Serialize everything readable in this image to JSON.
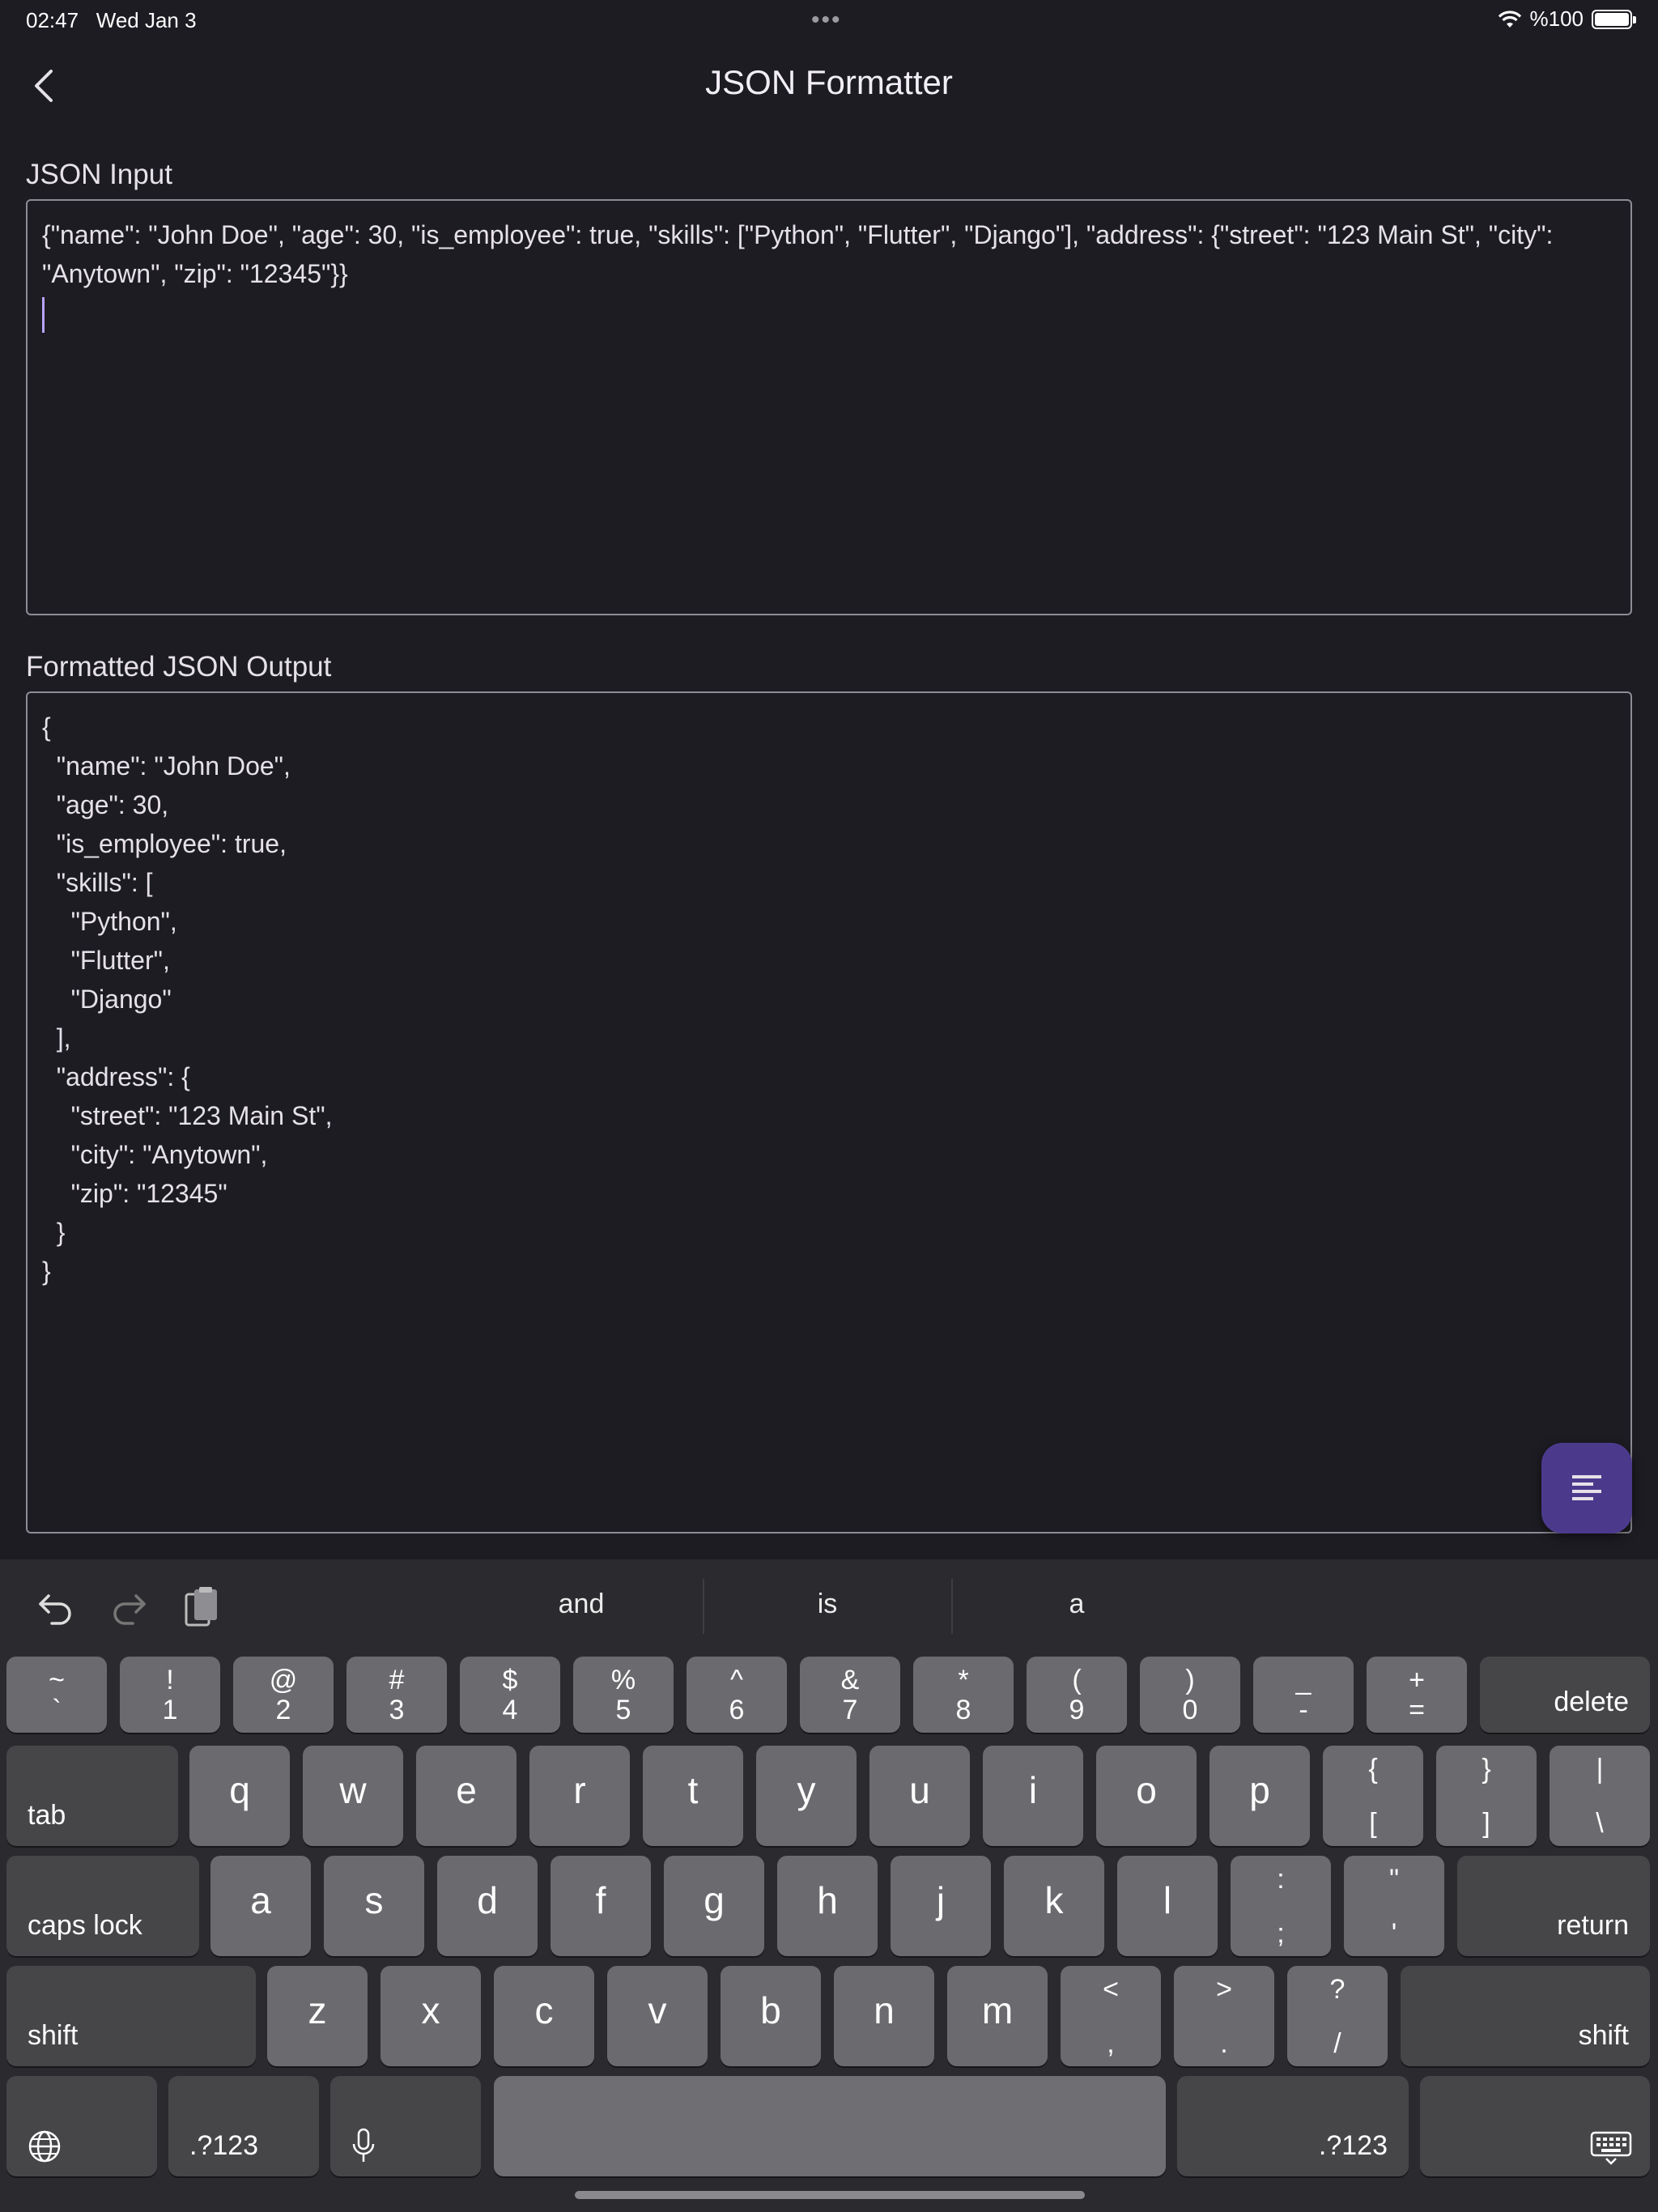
{
  "status": {
    "time": "02:47",
    "date": "Wed Jan 3",
    "battery": "%100",
    "dots": "•••"
  },
  "appbar": {
    "title": "JSON Formatter"
  },
  "input": {
    "label": "JSON Input",
    "value": "{\"name\": \"John Doe\", \"age\": 30, \"is_employee\": true, \"skills\": [\"Python\", \"Flutter\", \"Django\"], \"address\": {\"street\": \"123 Main St\", \"city\": \"Anytown\", \"zip\": \"12345\"}}\n"
  },
  "output": {
    "label": "Formatted JSON Output",
    "value": "{\n  \"name\": \"John Doe\",\n  \"age\": 30,\n  \"is_employee\": true,\n  \"skills\": [\n    \"Python\",\n    \"Flutter\",\n    \"Django\"\n  ],\n  \"address\": {\n    \"street\": \"123 Main St\",\n    \"city\": \"Anytown\",\n    \"zip\": \"12345\"\n  }\n}"
  },
  "keyboard": {
    "suggestions": [
      "and",
      "is",
      "a"
    ],
    "num": [
      [
        "~",
        "`"
      ],
      [
        "!",
        "1"
      ],
      [
        "@",
        "2"
      ],
      [
        "#",
        "3"
      ],
      [
        "$",
        "4"
      ],
      [
        "%",
        "5"
      ],
      [
        "^",
        "6"
      ],
      [
        "&",
        "7"
      ],
      [
        "*",
        "8"
      ],
      [
        "(",
        "9"
      ],
      [
        ")",
        "0"
      ],
      [
        "_",
        "-"
      ],
      [
        "+",
        "="
      ]
    ],
    "row1": [
      "q",
      "w",
      "e",
      "r",
      "t",
      "y",
      "u",
      "i",
      "o",
      "p"
    ],
    "row1_sym": [
      [
        "{",
        "["
      ],
      [
        "}",
        "]"
      ],
      [
        "|",
        "\\"
      ]
    ],
    "row2": [
      "a",
      "s",
      "d",
      "f",
      "g",
      "h",
      "j",
      "k",
      "l"
    ],
    "row2_sym": [
      [
        ":",
        ";"
      ],
      [
        "\"",
        "'"
      ]
    ],
    "row3": [
      "z",
      "x",
      "c",
      "v",
      "b",
      "n",
      "m"
    ],
    "row3_sym": [
      [
        "<",
        ","
      ],
      [
        ">",
        "."
      ],
      [
        "?",
        "/"
      ]
    ],
    "delete": "delete",
    "tab": "tab",
    "caps": "caps lock",
    "return": "return",
    "shift": "shift",
    "num_switch": ".?123"
  },
  "colors": {
    "accent": "#4b3a8c",
    "caret": "#b8a4ff",
    "background": "#1c1c22"
  }
}
